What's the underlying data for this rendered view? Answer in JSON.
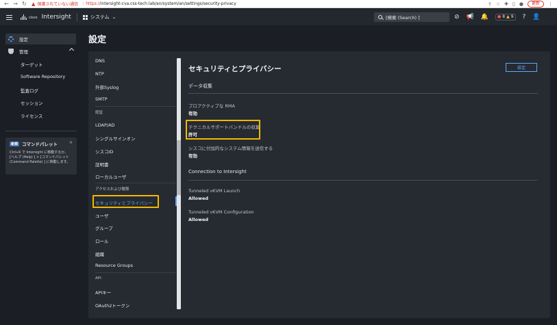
{
  "browser": {
    "insecure_label": "保護されていない通信",
    "url_scheme": "https://",
    "url_rest": "intersight-cva.css-tech.lab/an/system/an/settings/security-privacy",
    "update_label": "更新"
  },
  "header": {
    "cisco_text": "cisco",
    "brand": "Intersight",
    "context_label": "システム",
    "search_placeholder": "[検索 (Search) ]",
    "alert_red_count": "8",
    "alert_yellow_count": "9"
  },
  "sidebar": {
    "settings_label": "設定",
    "admin_label": "管理",
    "admin_items": [
      "ターゲット",
      "Software Repository",
      "監査ログ",
      "セッション",
      "ライセンス"
    ],
    "palette": {
      "new_badge": "新規",
      "title": "コマンドパレット",
      "close": "×",
      "body": "Ctrl+K で Intersight に移動するか、[ヘルプ (Help) ] > [コマンドパレット (Command Palette) ] に移動します。"
    }
  },
  "page": {
    "title": "設定"
  },
  "subnav": {
    "items": [
      {
        "label": "DNS"
      },
      {
        "label": "NTP"
      },
      {
        "label": "外部Syslog"
      },
      {
        "label": "SMTP"
      },
      {
        "label": "認証",
        "group": true
      },
      {
        "label": "LDAP/AD"
      },
      {
        "label": "シングルサインオン"
      },
      {
        "label": "シスコID"
      },
      {
        "label": "証明書"
      },
      {
        "label": "ローカルユーザ"
      },
      {
        "label": "アクセスおよび権限",
        "group": true
      },
      {
        "label": "セキュリティとプライバシー",
        "selected": true
      },
      {
        "label": "ユーザ"
      },
      {
        "label": "グループ"
      },
      {
        "label": "ロール"
      },
      {
        "label": "組織"
      },
      {
        "label": "Resource Groups"
      },
      {
        "label": "API",
        "group": true
      },
      {
        "label": "APIキー"
      },
      {
        "label": "OAuth2トークン"
      }
    ]
  },
  "content": {
    "title": "セキュリティとプライバシー",
    "settings_button": "設定",
    "data_collection": {
      "heading": "データ収集",
      "fields": [
        {
          "label": "プロアクティブな RMA",
          "value": "有効"
        },
        {
          "label": "テクニカルサポートバンドルの収集",
          "value": "許可"
        },
        {
          "label": "シスコに付加的なシステム情報を送信する",
          "value": "有効"
        }
      ]
    },
    "connection": {
      "heading": "Connection to Intersight",
      "fields": [
        {
          "label": "Tunneled vKVM Launch",
          "value": "Allowed"
        },
        {
          "label": "Tunneled vKVM Configuration",
          "value": "Allowed"
        }
      ]
    }
  },
  "colors": {
    "accent": "#5fa8ff",
    "highlight": "#f5b800",
    "background": "#1b1f25",
    "panel": "#262a31"
  }
}
